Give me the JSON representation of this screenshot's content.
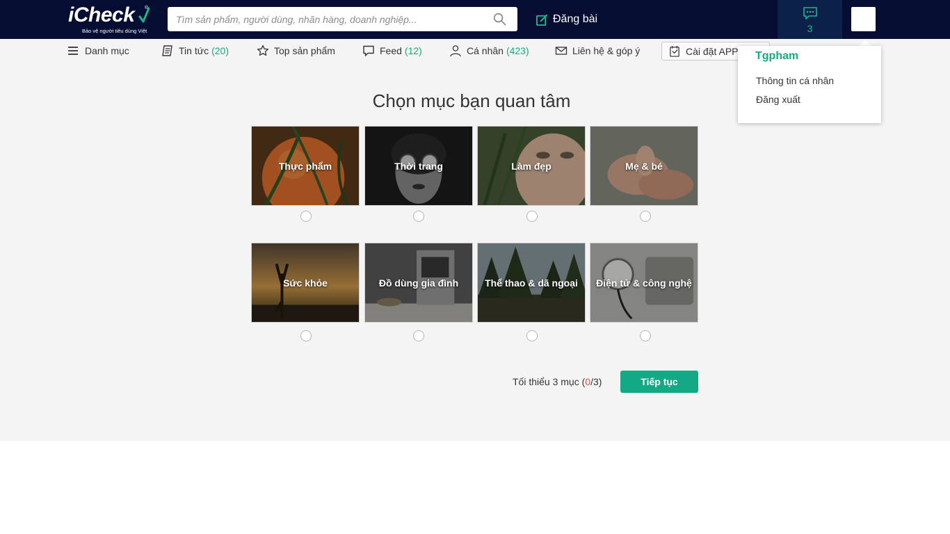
{
  "header": {
    "logo_text": "iCheck",
    "logo_tagline": "Bảo vệ người tiêu dùng Việt",
    "search_placeholder": "Tìm sản phẩm, người dùng, nhãn hàng, doanh nghiệp...",
    "post_label": "Đăng bài",
    "message_count": "3"
  },
  "nav": {
    "menu_label": "Danh mục",
    "news_label": "Tin tức",
    "news_count": "(20)",
    "top_products_label": "Top sản phẩm",
    "feed_label": "Feed",
    "feed_count": "(12)",
    "personal_label": "Cá nhân",
    "personal_count": "(423)",
    "contact_label": "Liên hệ & góp ý",
    "install_app_label": "Cài đặt APP i"
  },
  "main": {
    "heading": "Chọn mục bạn quan tâm",
    "categories": [
      {
        "label": "Thực phẩm",
        "selected": false
      },
      {
        "label": "Thời trang",
        "selected": false
      },
      {
        "label": "Làm đẹp",
        "selected": false
      },
      {
        "label": "Mẹ & bé",
        "selected": false
      },
      {
        "label": "Sức khỏe",
        "selected": false
      },
      {
        "label": "Đồ dùng gia đình",
        "selected": false
      },
      {
        "label": "Thể thao & dã ngoại",
        "selected": false
      },
      {
        "label": "Điện tử & công nghệ",
        "selected": false
      }
    ],
    "footer": {
      "min_prefix": "Tối thiểu 3 mục (",
      "selected_count": "0",
      "min_suffix": "/3)",
      "continue_label": "Tiếp tục"
    }
  },
  "dropdown": {
    "username": "Tgpham",
    "items": [
      "Thông tin cá nhân",
      "Đăng xuất"
    ]
  },
  "colors": {
    "header_bg": "#050d32",
    "accent": "#12a984",
    "message_box_bg": "#0b2149",
    "selected_count": "#e44b4b"
  }
}
